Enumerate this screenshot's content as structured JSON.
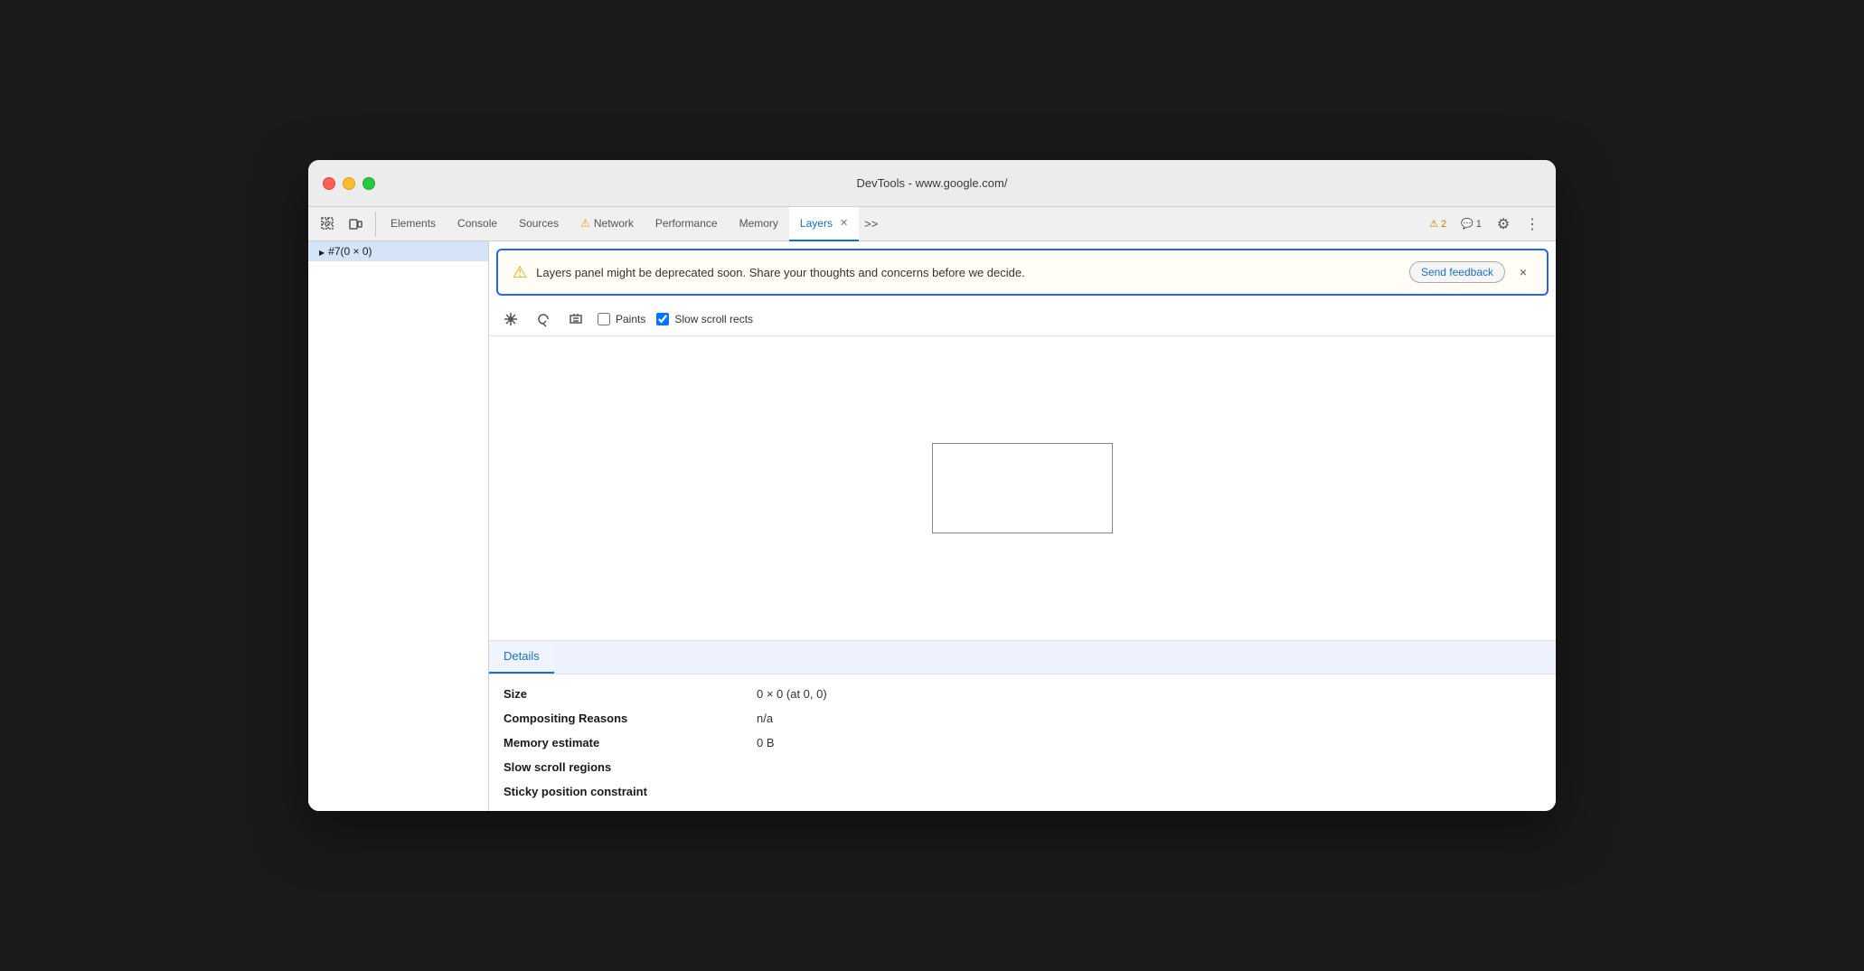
{
  "window": {
    "title": "DevTools - www.google.com/"
  },
  "tabs": {
    "items": [
      {
        "id": "elements",
        "label": "Elements",
        "active": false,
        "warning": false
      },
      {
        "id": "console",
        "label": "Console",
        "active": false,
        "warning": false
      },
      {
        "id": "sources",
        "label": "Sources",
        "active": false,
        "warning": false
      },
      {
        "id": "network",
        "label": "Network",
        "active": false,
        "warning": true
      },
      {
        "id": "performance",
        "label": "Performance",
        "active": false,
        "warning": false
      },
      {
        "id": "memory",
        "label": "Memory",
        "active": false,
        "warning": false
      },
      {
        "id": "layers",
        "label": "Layers",
        "active": true,
        "warning": false
      }
    ],
    "more_label": ">>",
    "warning_count": "2",
    "info_count": "1"
  },
  "warning_banner": {
    "text": "Layers panel might be deprecated soon. Share your thoughts and concerns before we decide.",
    "send_feedback_label": "Send feedback",
    "close_label": "×"
  },
  "toolbar": {
    "paints_label": "Paints",
    "slow_scroll_rects_label": "Slow scroll rects"
  },
  "sidebar": {
    "items": [
      {
        "label": "#7(0 × 0)",
        "selected": true
      }
    ]
  },
  "details": {
    "tab_label": "Details",
    "rows": [
      {
        "key": "Size",
        "value": "0 × 0 (at 0, 0)"
      },
      {
        "key": "Compositing Reasons",
        "value": "n/a"
      },
      {
        "key": "Memory estimate",
        "value": "0 B"
      },
      {
        "key": "Slow scroll regions",
        "value": ""
      },
      {
        "key": "Sticky position constraint",
        "value": ""
      }
    ]
  }
}
